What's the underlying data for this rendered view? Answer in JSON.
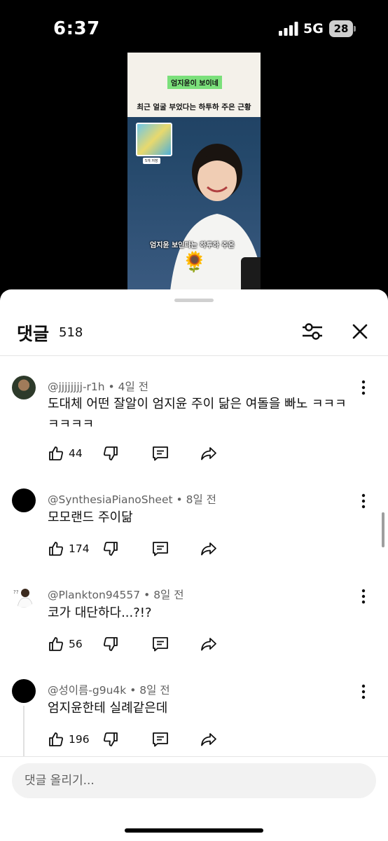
{
  "status_bar": {
    "time": "6:37",
    "network": "5G",
    "battery": "28"
  },
  "video": {
    "highlight": "엄지윤이 보이네",
    "subtitle": "최근 얼굴 부었다는 하투하 주은 근황",
    "thumb_label": "5개 저장",
    "overlay_text": "엄지윤 보인다는 하투하 주은",
    "sticker": "🌻"
  },
  "comments_panel": {
    "title": "댓글",
    "count": "518",
    "input_placeholder": "댓글 올리기..."
  },
  "comments": [
    {
      "author": "@jjjjjjjj-r1h",
      "time": "4일 전",
      "text_lines": [
        "도대체 어떤 잘알이 엄지윤 주이 닮은 여돌을 빠노 ㅋㅋㅋ",
        "ㅋㅋㅋㅋ"
      ],
      "likes": "44"
    },
    {
      "author": "@SynthesiaPianoSheet",
      "time": "8일 전",
      "text_lines": [
        "모모랜드 주이닮"
      ],
      "likes": "174"
    },
    {
      "author": "@Plankton94557",
      "time": "8일 전",
      "text_lines": [
        "코가 대단하다...?!?"
      ],
      "likes": "56"
    },
    {
      "author": "@성이름-g9u4k",
      "time": "8일 전",
      "text_lines": [
        "엄지윤한테 실례같은데"
      ],
      "likes": "196"
    }
  ],
  "meta_separator": "•",
  "colors": {
    "background": "#000000",
    "sheet": "#ffffff",
    "secondary_text": "#606060",
    "input_bg": "#f2f2f2"
  }
}
